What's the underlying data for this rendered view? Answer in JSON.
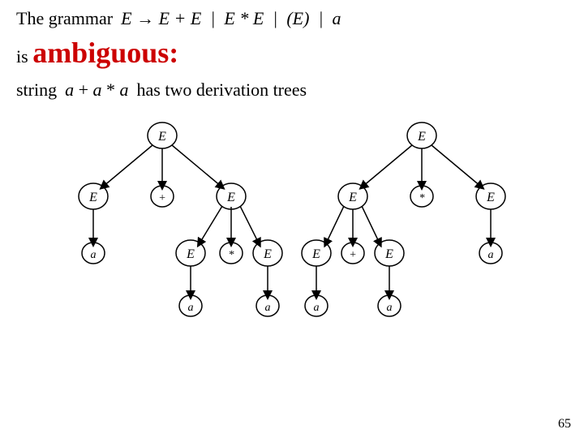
{
  "header": {
    "grammar_label": "The grammar",
    "formula": "E → E + E  |  E * E  |  (E)  |  a"
  },
  "line2": {
    "is": "is ",
    "ambiguous": "ambiguous:"
  },
  "line3": {
    "string_label": "string",
    "string_formula": "a + a * a",
    "has_text": "has two derivation trees"
  },
  "page_number": "65"
}
